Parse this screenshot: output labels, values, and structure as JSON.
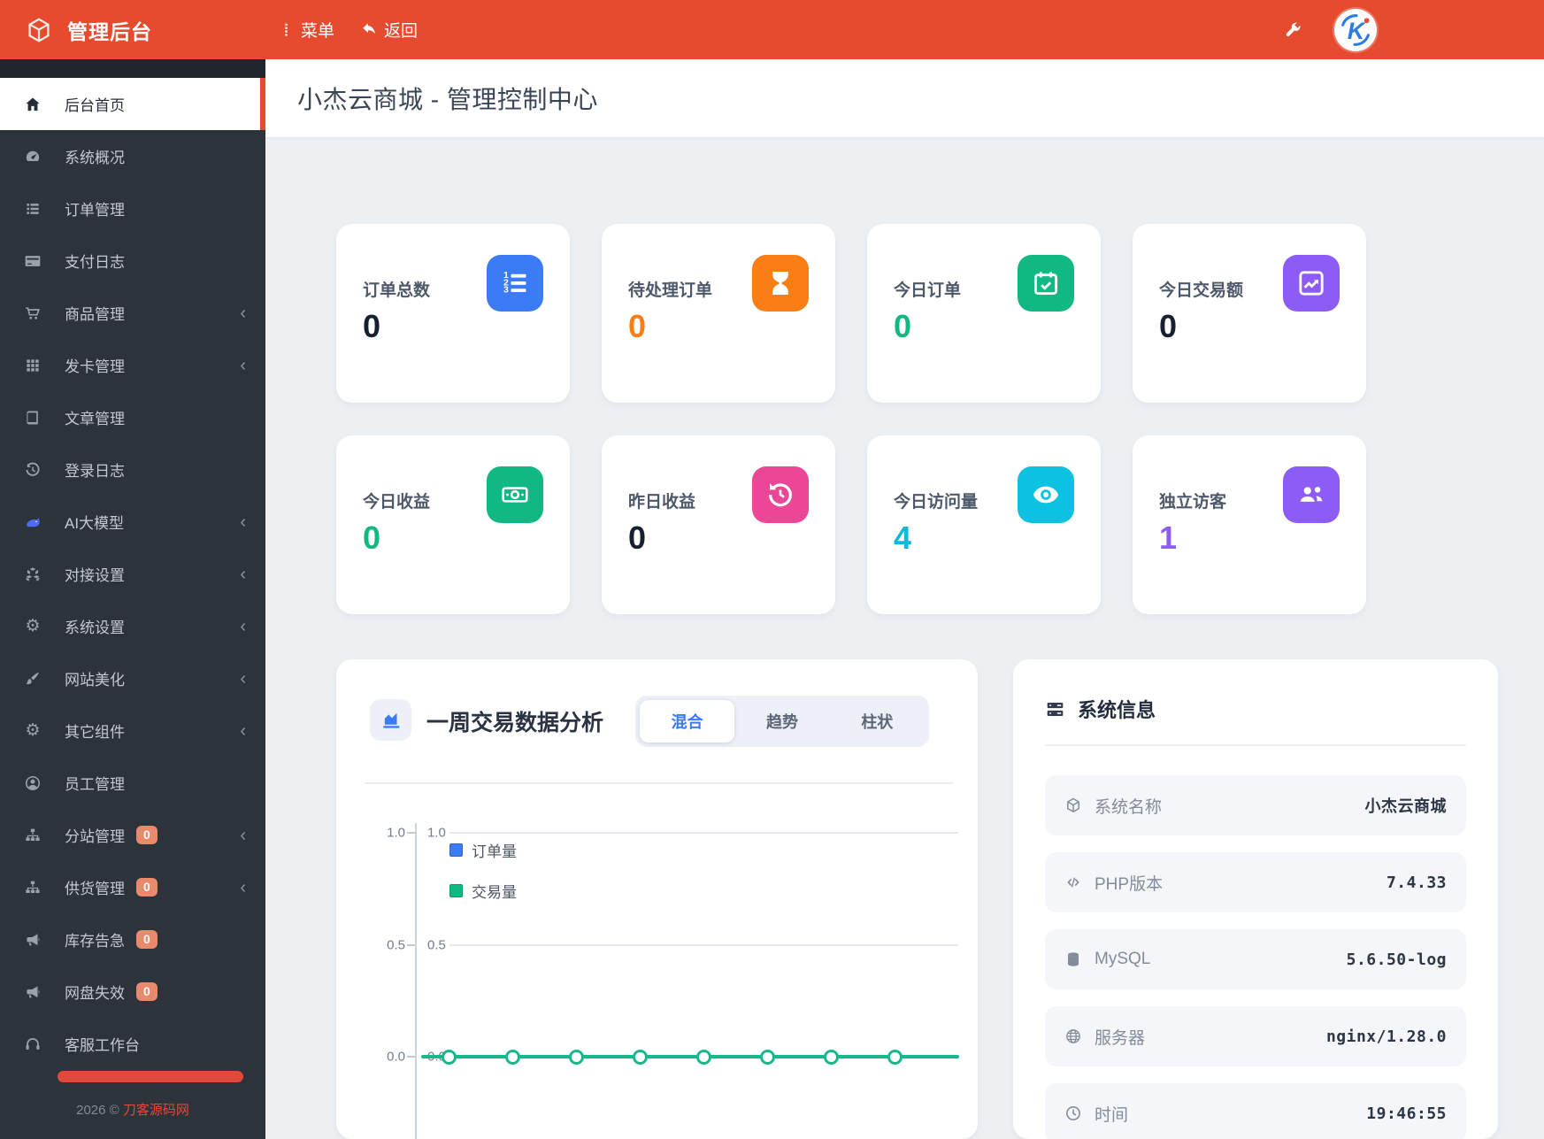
{
  "colors": {
    "header_red": "#e64b2f",
    "sidebar_bg": "#2d333a",
    "badge_orange": "#e98a6d",
    "content_bg": "#ecf0f3",
    "accent_blue": "#3c7bf6",
    "accent_orange": "#fb7e14",
    "accent_green": "#0fb981",
    "accent_purple": "#8d5cf6",
    "accent_pink": "#ec4796",
    "accent_cyan": "#0cc2e0",
    "line_green": "#17b98c"
  },
  "topbar": {
    "brand": "管理后台",
    "menu_label": "菜单",
    "back_label": "返回"
  },
  "page": {
    "title": "小杰云商城 - 管理控制中心"
  },
  "sidebar": {
    "items": [
      {
        "label": "后台首页",
        "icon": "home"
      },
      {
        "label": "系统概况",
        "icon": "gauge"
      },
      {
        "label": "订单管理",
        "icon": "list"
      },
      {
        "label": "支付日志",
        "icon": "card"
      },
      {
        "label": "商品管理",
        "icon": "cart"
      },
      {
        "label": "发卡管理",
        "icon": "grid"
      },
      {
        "label": "文章管理",
        "icon": "book"
      },
      {
        "label": "登录日志",
        "icon": "history"
      },
      {
        "label": "AI大模型",
        "icon": "ai"
      },
      {
        "label": "对接设置",
        "icon": "cubes"
      },
      {
        "label": "系统设置",
        "icon": "gear"
      },
      {
        "label": "网站美化",
        "icon": "brush"
      },
      {
        "label": "其它组件",
        "icon": "gears"
      },
      {
        "label": "员工管理",
        "icon": "user"
      },
      {
        "label": "分站管理",
        "icon": "sitemap",
        "badge": "0"
      },
      {
        "label": "供货管理",
        "icon": "sitemap",
        "badge": "0"
      },
      {
        "label": "库存告急",
        "icon": "bullhorn",
        "badge": "0"
      },
      {
        "label": "网盘失效",
        "icon": "bullhorn",
        "badge": "0"
      },
      {
        "label": "客服工作台",
        "icon": "headset"
      }
    ],
    "footer_year": "2026 © ",
    "footer_site": "刀客源码网"
  },
  "stats": [
    {
      "label": "订单总数",
      "value": "0",
      "icon": "listol"
    },
    {
      "label": "待处理订单",
      "value": "0",
      "icon": "hourglass"
    },
    {
      "label": "今日订单",
      "value": "0",
      "icon": "calcheck"
    },
    {
      "label": "今日交易额",
      "value": "0",
      "icon": "chartline"
    },
    {
      "label": "今日收益",
      "value": "0",
      "icon": "money"
    },
    {
      "label": "昨日收益",
      "value": "0",
      "icon": "rotate"
    },
    {
      "label": "今日访问量",
      "value": "4",
      "icon": "eye"
    },
    {
      "label": "独立访客",
      "value": "1",
      "icon": "users"
    }
  ],
  "chart_panel": {
    "title": "一周交易数据分析",
    "tabs": [
      "混合",
      "趋势",
      "柱状"
    ],
    "active_tab": "混合",
    "legend": [
      "订单量",
      "交易量"
    ],
    "left_ticks": [
      "1.0",
      "0.5",
      "0.0"
    ],
    "right_ticks": [
      "1.0",
      "0.5",
      "0.0"
    ]
  },
  "chart_data": {
    "type": "line",
    "title": "一周交易数据分析",
    "categories": [
      "",
      "",
      "",
      "",
      "",
      "",
      ""
    ],
    "series": [
      {
        "name": "订单量",
        "color": "#3c7bf6",
        "values": [
          0,
          0,
          0,
          0,
          0,
          0,
          0
        ]
      },
      {
        "name": "交易量",
        "color": "#17b98c",
        "values": [
          0,
          0,
          0,
          0,
          0,
          0,
          0
        ]
      }
    ],
    "ylim": [
      0,
      1
    ],
    "y_ticks": [
      1.0,
      0.5,
      0.0
    ],
    "dual_y_axis": true,
    "grid": true,
    "legend_position": "top-left"
  },
  "system_panel": {
    "title": "系统信息",
    "rows": [
      {
        "label": "系统名称",
        "value": "小杰云商城",
        "icon": "cube"
      },
      {
        "label": "PHP版本",
        "value": "7.4.33",
        "icon": "code"
      },
      {
        "label": "MySQL",
        "value": "5.6.50-log",
        "icon": "db"
      },
      {
        "label": "服务器",
        "value": "nginx/1.28.0",
        "icon": "globe"
      },
      {
        "label": "时间",
        "value": "19:46:55",
        "icon": "clock"
      }
    ]
  }
}
